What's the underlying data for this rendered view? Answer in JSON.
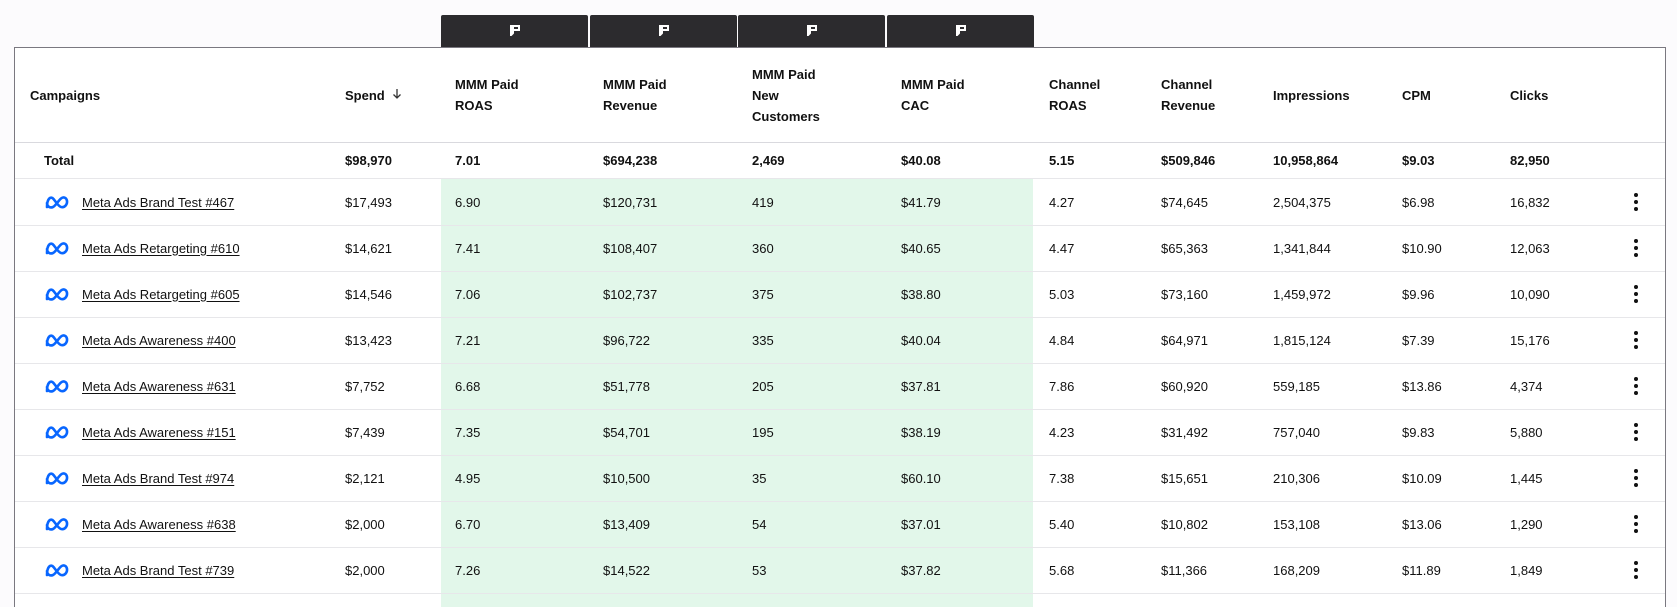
{
  "model_tabs": [
    {
      "icon": "mmm-model-icon"
    },
    {
      "icon": "mmm-model-icon"
    },
    {
      "icon": "mmm-model-icon"
    },
    {
      "icon": "mmm-model-icon"
    }
  ],
  "colors": {
    "highlight_column_bg": "#e2f7ea",
    "tab_bg": "#2c2b2e",
    "meta_blue": "#0866ff"
  },
  "table": {
    "headers": {
      "campaigns": "Campaigns",
      "spend": "Spend",
      "mmm_roas": [
        "MMM Paid",
        "ROAS"
      ],
      "mmm_revenue": [
        "MMM Paid",
        "Revenue"
      ],
      "mmm_new_customers": [
        "MMM Paid",
        "New",
        "Customers"
      ],
      "mmm_cac": [
        "MMM Paid",
        "CAC"
      ],
      "channel_roas": [
        "Channel",
        "ROAS"
      ],
      "channel_revenue": [
        "Channel",
        "Revenue"
      ],
      "impressions": "Impressions",
      "cpm": "CPM",
      "clicks": "Clicks"
    },
    "sort": {
      "column": "Spend",
      "direction": "desc",
      "icon": "arrow-down-icon"
    },
    "total": {
      "label": "Total",
      "spend": "$98,970",
      "mmm_roas": "7.01",
      "mmm_revenue": "$694,238",
      "mmm_new_customers": "2,469",
      "mmm_cac": "$40.08",
      "channel_roas": "5.15",
      "channel_revenue": "$509,846",
      "impressions": "10,958,864",
      "cpm": "$9.03",
      "clicks": "82,950"
    },
    "rows": [
      {
        "icon": "meta-icon",
        "name": "Meta Ads Brand Test #467",
        "spend": "$17,493",
        "mmm_roas": "6.90",
        "mmm_revenue": "$120,731",
        "mmm_new_customers": "419",
        "mmm_cac": "$41.79",
        "channel_roas": "4.27",
        "channel_revenue": "$74,645",
        "impressions": "2,504,375",
        "cpm": "$6.98",
        "clicks": "16,832"
      },
      {
        "icon": "meta-icon",
        "name": "Meta Ads Retargeting #610",
        "spend": "$14,621",
        "mmm_roas": "7.41",
        "mmm_revenue": "$108,407",
        "mmm_new_customers": "360",
        "mmm_cac": "$40.65",
        "channel_roas": "4.47",
        "channel_revenue": "$65,363",
        "impressions": "1,341,844",
        "cpm": "$10.90",
        "clicks": "12,063"
      },
      {
        "icon": "meta-icon",
        "name": "Meta Ads Retargeting #605",
        "spend": "$14,546",
        "mmm_roas": "7.06",
        "mmm_revenue": "$102,737",
        "mmm_new_customers": "375",
        "mmm_cac": "$38.80",
        "channel_roas": "5.03",
        "channel_revenue": "$73,160",
        "impressions": "1,459,972",
        "cpm": "$9.96",
        "clicks": "10,090"
      },
      {
        "icon": "meta-icon",
        "name": "Meta Ads Awareness #400",
        "spend": "$13,423",
        "mmm_roas": "7.21",
        "mmm_revenue": "$96,722",
        "mmm_new_customers": "335",
        "mmm_cac": "$40.04",
        "channel_roas": "4.84",
        "channel_revenue": "$64,971",
        "impressions": "1,815,124",
        "cpm": "$7.39",
        "clicks": "15,176"
      },
      {
        "icon": "meta-icon",
        "name": "Meta Ads Awareness #631",
        "spend": "$7,752",
        "mmm_roas": "6.68",
        "mmm_revenue": "$51,778",
        "mmm_new_customers": "205",
        "mmm_cac": "$37.81",
        "channel_roas": "7.86",
        "channel_revenue": "$60,920",
        "impressions": "559,185",
        "cpm": "$13.86",
        "clicks": "4,374"
      },
      {
        "icon": "meta-icon",
        "name": "Meta Ads Awareness #151",
        "spend": "$7,439",
        "mmm_roas": "7.35",
        "mmm_revenue": "$54,701",
        "mmm_new_customers": "195",
        "mmm_cac": "$38.19",
        "channel_roas": "4.23",
        "channel_revenue": "$31,492",
        "impressions": "757,040",
        "cpm": "$9.83",
        "clicks": "5,880"
      },
      {
        "icon": "meta-icon",
        "name": "Meta Ads Brand Test #974",
        "spend": "$2,121",
        "mmm_roas": "4.95",
        "mmm_revenue": "$10,500",
        "mmm_new_customers": "35",
        "mmm_cac": "$60.10",
        "channel_roas": "7.38",
        "channel_revenue": "$15,651",
        "impressions": "210,306",
        "cpm": "$10.09",
        "clicks": "1,445"
      },
      {
        "icon": "meta-icon",
        "name": "Meta Ads Awareness #638",
        "spend": "$2,000",
        "mmm_roas": "6.70",
        "mmm_revenue": "$13,409",
        "mmm_new_customers": "54",
        "mmm_cac": "$37.01",
        "channel_roas": "5.40",
        "channel_revenue": "$10,802",
        "impressions": "153,108",
        "cpm": "$13.06",
        "clicks": "1,290"
      },
      {
        "icon": "meta-icon",
        "name": "Meta Ads Brand Test #739",
        "spend": "$2,000",
        "mmm_roas": "7.26",
        "mmm_revenue": "$14,522",
        "mmm_new_customers": "53",
        "mmm_cac": "$37.82",
        "channel_roas": "5.68",
        "channel_revenue": "$11,366",
        "impressions": "168,209",
        "cpm": "$11.89",
        "clicks": "1,849"
      }
    ]
  }
}
